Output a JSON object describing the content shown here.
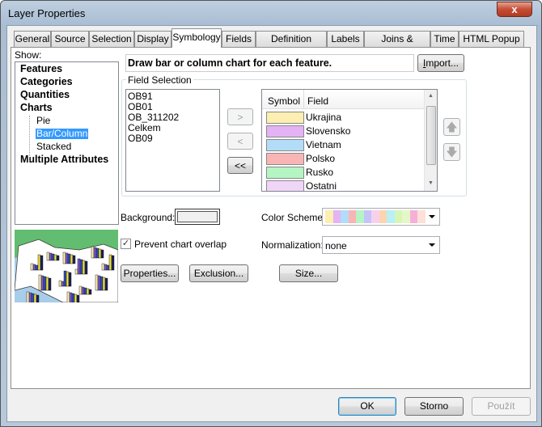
{
  "window": {
    "title": "Layer Properties",
    "close": "x"
  },
  "tabs": [
    "General",
    "Source",
    "Selection",
    "Display",
    "Symbology",
    "Fields",
    "Definition Query",
    "Labels",
    "Joins & Relates",
    "Time",
    "HTML Popup"
  ],
  "active_tab": "Symbology",
  "show": {
    "label": "Show:",
    "items": [
      {
        "label": "Features",
        "bold": true
      },
      {
        "label": "Categories",
        "bold": true
      },
      {
        "label": "Quantities",
        "bold": true
      },
      {
        "label": "Charts",
        "bold": true
      },
      {
        "label": "Pie"
      },
      {
        "label": "Bar/Column",
        "selected": true
      },
      {
        "label": "Stacked"
      },
      {
        "label": "Multiple Attributes",
        "bold": true
      }
    ]
  },
  "description": "Draw bar or column chart for each feature.",
  "import_label": "Import...",
  "field_selection": {
    "label": "Field Selection",
    "available": [
      "OB91",
      "OB01",
      "OB_311202",
      "Celkem",
      "OB09"
    ],
    "add": ">",
    "remove": "<",
    "remove_all": "<<",
    "col_symbol": "Symbol",
    "col_field": "Field",
    "selected": [
      {
        "field": "Ukrajina",
        "color": "#fdeeb2"
      },
      {
        "field": "Slovensko",
        "color": "#e3b3f5"
      },
      {
        "field": "Vietnam",
        "color": "#b3dcf8"
      },
      {
        "field": "Polsko",
        "color": "#f9b5b5"
      },
      {
        "field": "Rusko",
        "color": "#b5f5c4"
      },
      {
        "field": "Ostatni",
        "color": "#efd6f7"
      }
    ]
  },
  "background_label": "Background:",
  "color_scheme_label": "Color Scheme:",
  "color_scheme": [
    "#fdeeb2",
    "#e3b3f5",
    "#b3dcf8",
    "#f9b5b5",
    "#b5f5c4",
    "#c4c4f7",
    "#f7d0ee",
    "#fdd4b0",
    "#b8f0f5",
    "#d8f5b8",
    "#e5f7c8",
    "#f5b0d8",
    "#fde0d8"
  ],
  "prevent_overlap": {
    "label": "Prevent chart overlap",
    "checked": true
  },
  "normalization_label": "Normalization:",
  "normalization": "none",
  "buttons": {
    "properties": "Properties...",
    "exclusion": "Exclusion...",
    "size": "Size...",
    "ok": "OK",
    "cancel": "Storno",
    "apply": "Použít"
  }
}
